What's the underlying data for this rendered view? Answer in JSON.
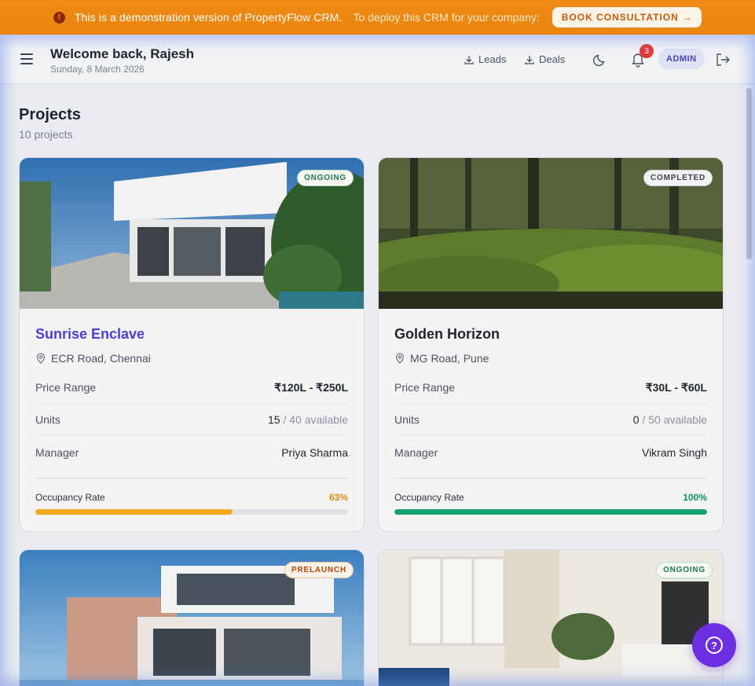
{
  "banner": {
    "message": "This is a demonstration version of PropertyFlow CRM.",
    "sub": "To deploy this CRM for your company:",
    "cta": "BOOK CONSULTATION →"
  },
  "header": {
    "welcome": "Welcome back, Rajesh",
    "date": "Sunday, 8 March 2026",
    "leads_label": "Leads",
    "deals_label": "Deals",
    "notification_count": "3",
    "role": "ADMIN"
  },
  "page": {
    "title": "Projects",
    "count": "10 projects"
  },
  "labels": {
    "price_range": "Price Range",
    "units": "Units",
    "manager": "Manager",
    "occupancy": "Occupancy Rate"
  },
  "projects": [
    {
      "status": "ONGOING",
      "name": "Sunrise Enclave",
      "location": "ECR Road, Chennai",
      "price": "₹120L - ₹250L",
      "units_available": "15",
      "units_total": "/ 40 available",
      "manager": "Priya Sharma",
      "occupancy": "63%",
      "occupancy_value": 0.63,
      "bar_color": "#f0a81c",
      "pct_color": "#e08a12"
    },
    {
      "status": "COMPLETED",
      "name": "Golden Horizon",
      "location": "MG Road, Pune",
      "price": "₹30L - ₹60L",
      "units_available": "0",
      "units_total": "/ 50 available",
      "manager": "Vikram Singh",
      "occupancy": "100%",
      "occupancy_value": 1.0,
      "bar_color": "#16a06a",
      "pct_color": "#16935f"
    },
    {
      "status": "PRELAUNCH"
    },
    {
      "status": "ONGOING"
    }
  ]
}
